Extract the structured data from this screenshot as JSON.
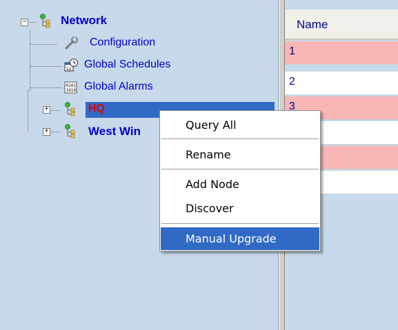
{
  "tree": {
    "root_label": "Network",
    "children": [
      {
        "label": "Configuration",
        "icon": "wrench-icon"
      },
      {
        "label": "Global Schedules",
        "icon": "calendar-clock-icon"
      },
      {
        "label": "Global Alarms",
        "icon": "binary-alarm-icon"
      }
    ],
    "hq_label": "HQ",
    "west_label": "West Win"
  },
  "grid": {
    "header": "Name",
    "rows": [
      "1",
      "2",
      "3",
      "",
      "",
      ""
    ]
  },
  "context_menu": {
    "items": [
      "Query All",
      "Rename",
      "Add Node",
      "Discover",
      "Manual Upgrade"
    ],
    "selected": "Manual Upgrade"
  },
  "colors": {
    "pane_background": "#c7d9ea",
    "selection": "#316ac5",
    "row_pink": "#f8b6b6",
    "tree_text": "#0000cc",
    "hq_text": "#e00000"
  }
}
